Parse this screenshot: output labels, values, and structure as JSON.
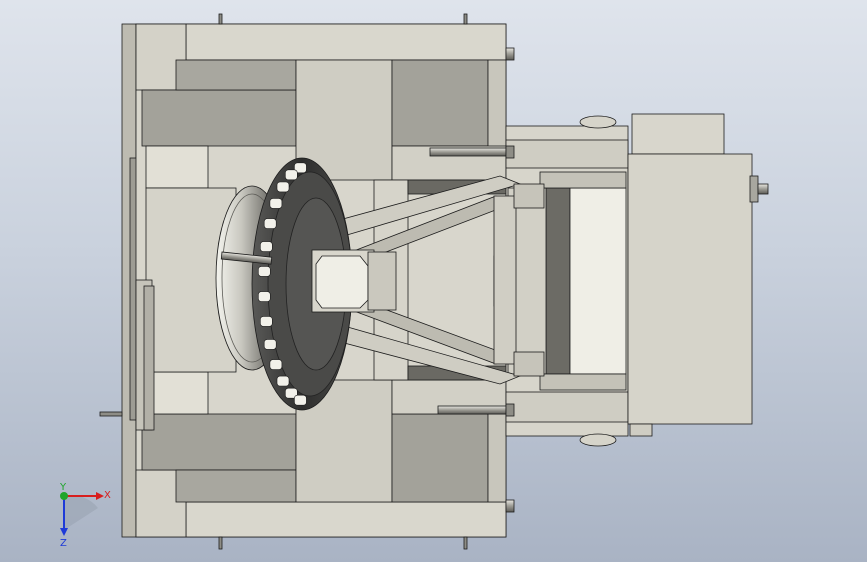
{
  "triad": {
    "x_label": "X",
    "y_label": "Y",
    "z_label": "Z",
    "x_color": "#d81e1e",
    "y_color": "#1fa52b",
    "z_color": "#1e3ad8"
  },
  "colors": {
    "plate_light": "#d8d6cc",
    "plate_mid": "#cbc9be",
    "plate_dark": "#a3a29a",
    "edge": "#1c1c1c",
    "cutter_dark": "#3c3c3c"
  }
}
